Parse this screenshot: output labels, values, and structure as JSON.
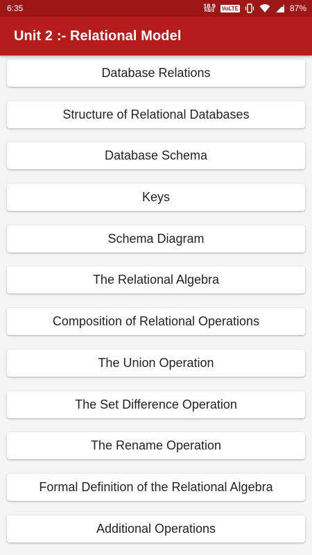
{
  "status_bar": {
    "time": "6:35",
    "net_speed_value": "18.9",
    "net_speed_unit": "KB/S",
    "volte_badge": "VoLTE",
    "battery_percent": "87%",
    "icons": [
      "vibrate-icon",
      "wifi-icon",
      "cellular-signal-icon"
    ]
  },
  "app_bar": {
    "title": "Unit 2 :- Relational Model"
  },
  "topics": [
    "Database Relations",
    "Structure of Relational Databases",
    "Database Schema",
    "Keys",
    "Schema Diagram",
    "The Relational Algebra",
    "Composition of Relational Operations",
    "The Union Operation",
    "The Set Difference Operation",
    "The Rename Operation",
    "Formal Definition of the Relational Algebra",
    "Additional Operations"
  ],
  "colors": {
    "status_bar": "#9e1717",
    "app_bar": "#b71c1c",
    "background": "#f5f5f5",
    "card": "#ffffff"
  }
}
